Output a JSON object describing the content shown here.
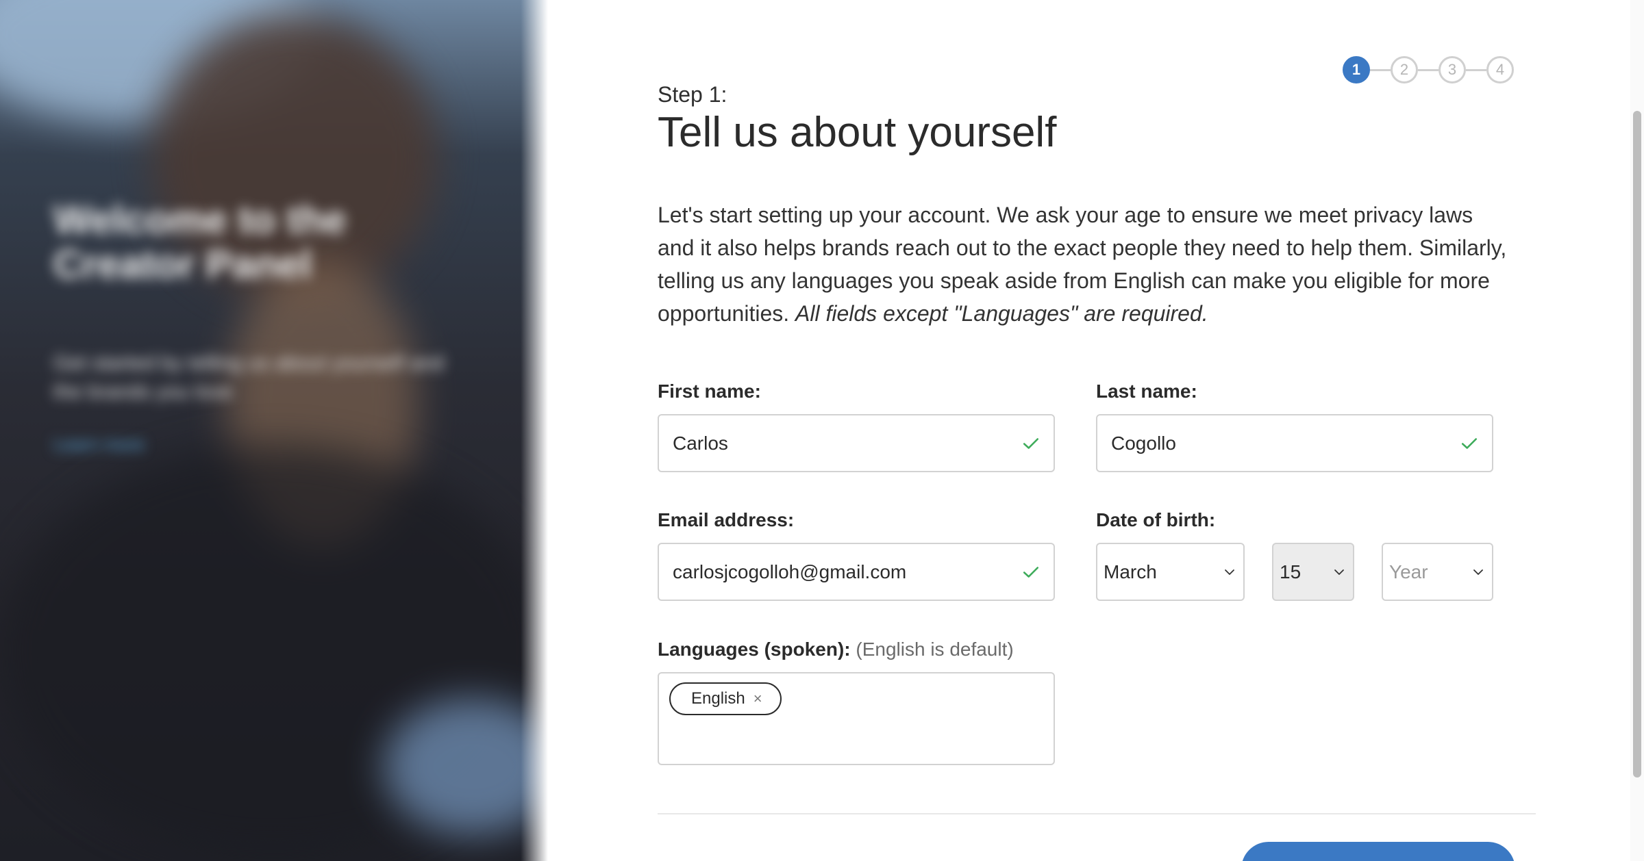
{
  "hero": {
    "title": "Welcome to the Creator Panel",
    "subtitle": "Get started by telling us about yourself and the brands you love",
    "link": "Learn more"
  },
  "stepper": {
    "steps": [
      "1",
      "2",
      "3",
      "4"
    ],
    "active_step": 1
  },
  "page": {
    "step_label": "Step 1:",
    "title": "Tell us about yourself",
    "intro_text": "Let's start setting up your account. We ask your age to ensure we meet privacy laws and it also helps brands reach out to the exact people they need to help them. Similarly, telling us any languages you speak aside from English can make you eligible for more opportunities.",
    "intro_italic": "All fields except \"Languages\" are required."
  },
  "form": {
    "first_name": {
      "label": "First name:",
      "value": "Carlos"
    },
    "last_name": {
      "label": "Last name:",
      "value": "Cogollo"
    },
    "email": {
      "label": "Email address:",
      "value": "carlosjcogolloh@gmail.com"
    },
    "dob": {
      "label": "Date of birth:",
      "month": "March",
      "day": "15",
      "year_placeholder": "Year"
    },
    "languages": {
      "label": "Languages (spoken):",
      "hint": "(English is default)",
      "chips": [
        "English"
      ]
    }
  },
  "colors": {
    "accent": "#3b79c4",
    "success": "#3dab5a",
    "border": "#d2d2d2"
  },
  "icons": {
    "valid": "check-icon",
    "dropdown": "chevron-down-icon",
    "remove": "close-icon"
  }
}
